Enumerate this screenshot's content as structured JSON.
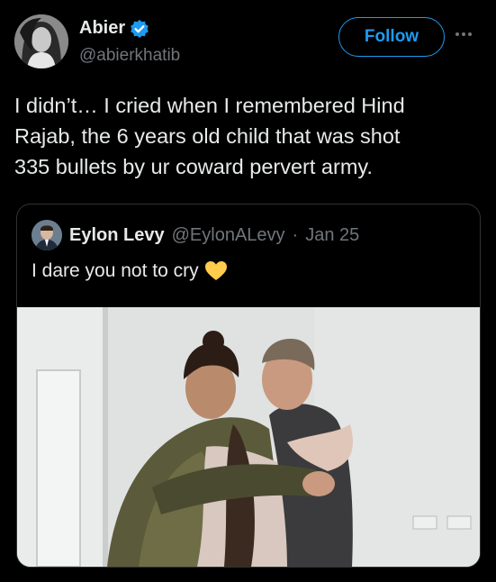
{
  "author": {
    "display_name": "Abier",
    "handle": "@abierkhatib",
    "verified": true,
    "avatar_icon": "profile-photo"
  },
  "actions": {
    "follow_label": "Follow",
    "more_icon": "ellipsis-icon"
  },
  "tweet": {
    "text": "I didn’t… I cried when I remembered Hind\nRajab, the 6 years old child that was shot\n335 bullets by ur coward pervert army."
  },
  "quote": {
    "display_name": "Eylon Levy",
    "handle": "@EylonALevy",
    "separator": "·",
    "date": "Jan 25",
    "text": "I dare you not to cry",
    "emoji_icon": "yellow-heart-icon"
  },
  "colors": {
    "background": "#000000",
    "accent": "#1d9bf0",
    "text_primary": "#e7e9ea",
    "text_secondary": "#71767b",
    "border": "#2f3336",
    "heart": "#ffcc4d"
  }
}
